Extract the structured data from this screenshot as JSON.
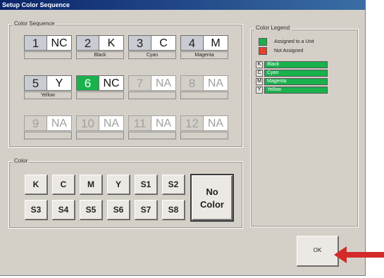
{
  "window": {
    "title": "Setup Color Sequence"
  },
  "sequence": {
    "group_label": "Color Sequence",
    "slots": [
      {
        "num": "1",
        "code": "NC",
        "name": "",
        "state": "normal"
      },
      {
        "num": "2",
        "code": "K",
        "name": "Black",
        "state": "normal"
      },
      {
        "num": "3",
        "code": "C",
        "name": "Cyan",
        "state": "normal"
      },
      {
        "num": "4",
        "code": "M",
        "name": "Magenta",
        "state": "normal"
      },
      {
        "num": "5",
        "code": "Y",
        "name": "Yellow",
        "state": "normal"
      },
      {
        "num": "6",
        "code": "NC",
        "name": "",
        "state": "assigned"
      },
      {
        "num": "7",
        "code": "NA",
        "name": "",
        "state": "disabled"
      },
      {
        "num": "8",
        "code": "NA",
        "name": "",
        "state": "disabled"
      },
      {
        "num": "9",
        "code": "NA",
        "name": "",
        "state": "disabled"
      },
      {
        "num": "10",
        "code": "NA",
        "name": "",
        "state": "disabled"
      },
      {
        "num": "11",
        "code": "NA",
        "name": "",
        "state": "disabled"
      },
      {
        "num": "12",
        "code": "NA",
        "name": "",
        "state": "disabled"
      }
    ]
  },
  "color": {
    "group_label": "Color",
    "buttons": [
      "K",
      "C",
      "M",
      "Y",
      "S1",
      "S2",
      "S3",
      "S4",
      "S5",
      "S6",
      "S7",
      "S8"
    ],
    "no_color_line1": "No",
    "no_color_line2": "Color"
  },
  "legend": {
    "group_label": "Color Legend",
    "assigned_label": "Assigned to a Unit",
    "not_assigned_label": "Not Assigned",
    "assigned_color": "#19b24c",
    "not_assigned_color": "#e8402a",
    "items": [
      {
        "code": "K",
        "name": "Black"
      },
      {
        "code": "C",
        "name": "Cyan"
      },
      {
        "code": "M",
        "name": "Magenta"
      },
      {
        "code": "Y",
        "name": "Yellow"
      }
    ]
  },
  "footer": {
    "ok_label": "OK"
  },
  "annotation": {
    "arrow_color": "#d42a2a",
    "arrow_icon": "red-arrow-icon"
  }
}
